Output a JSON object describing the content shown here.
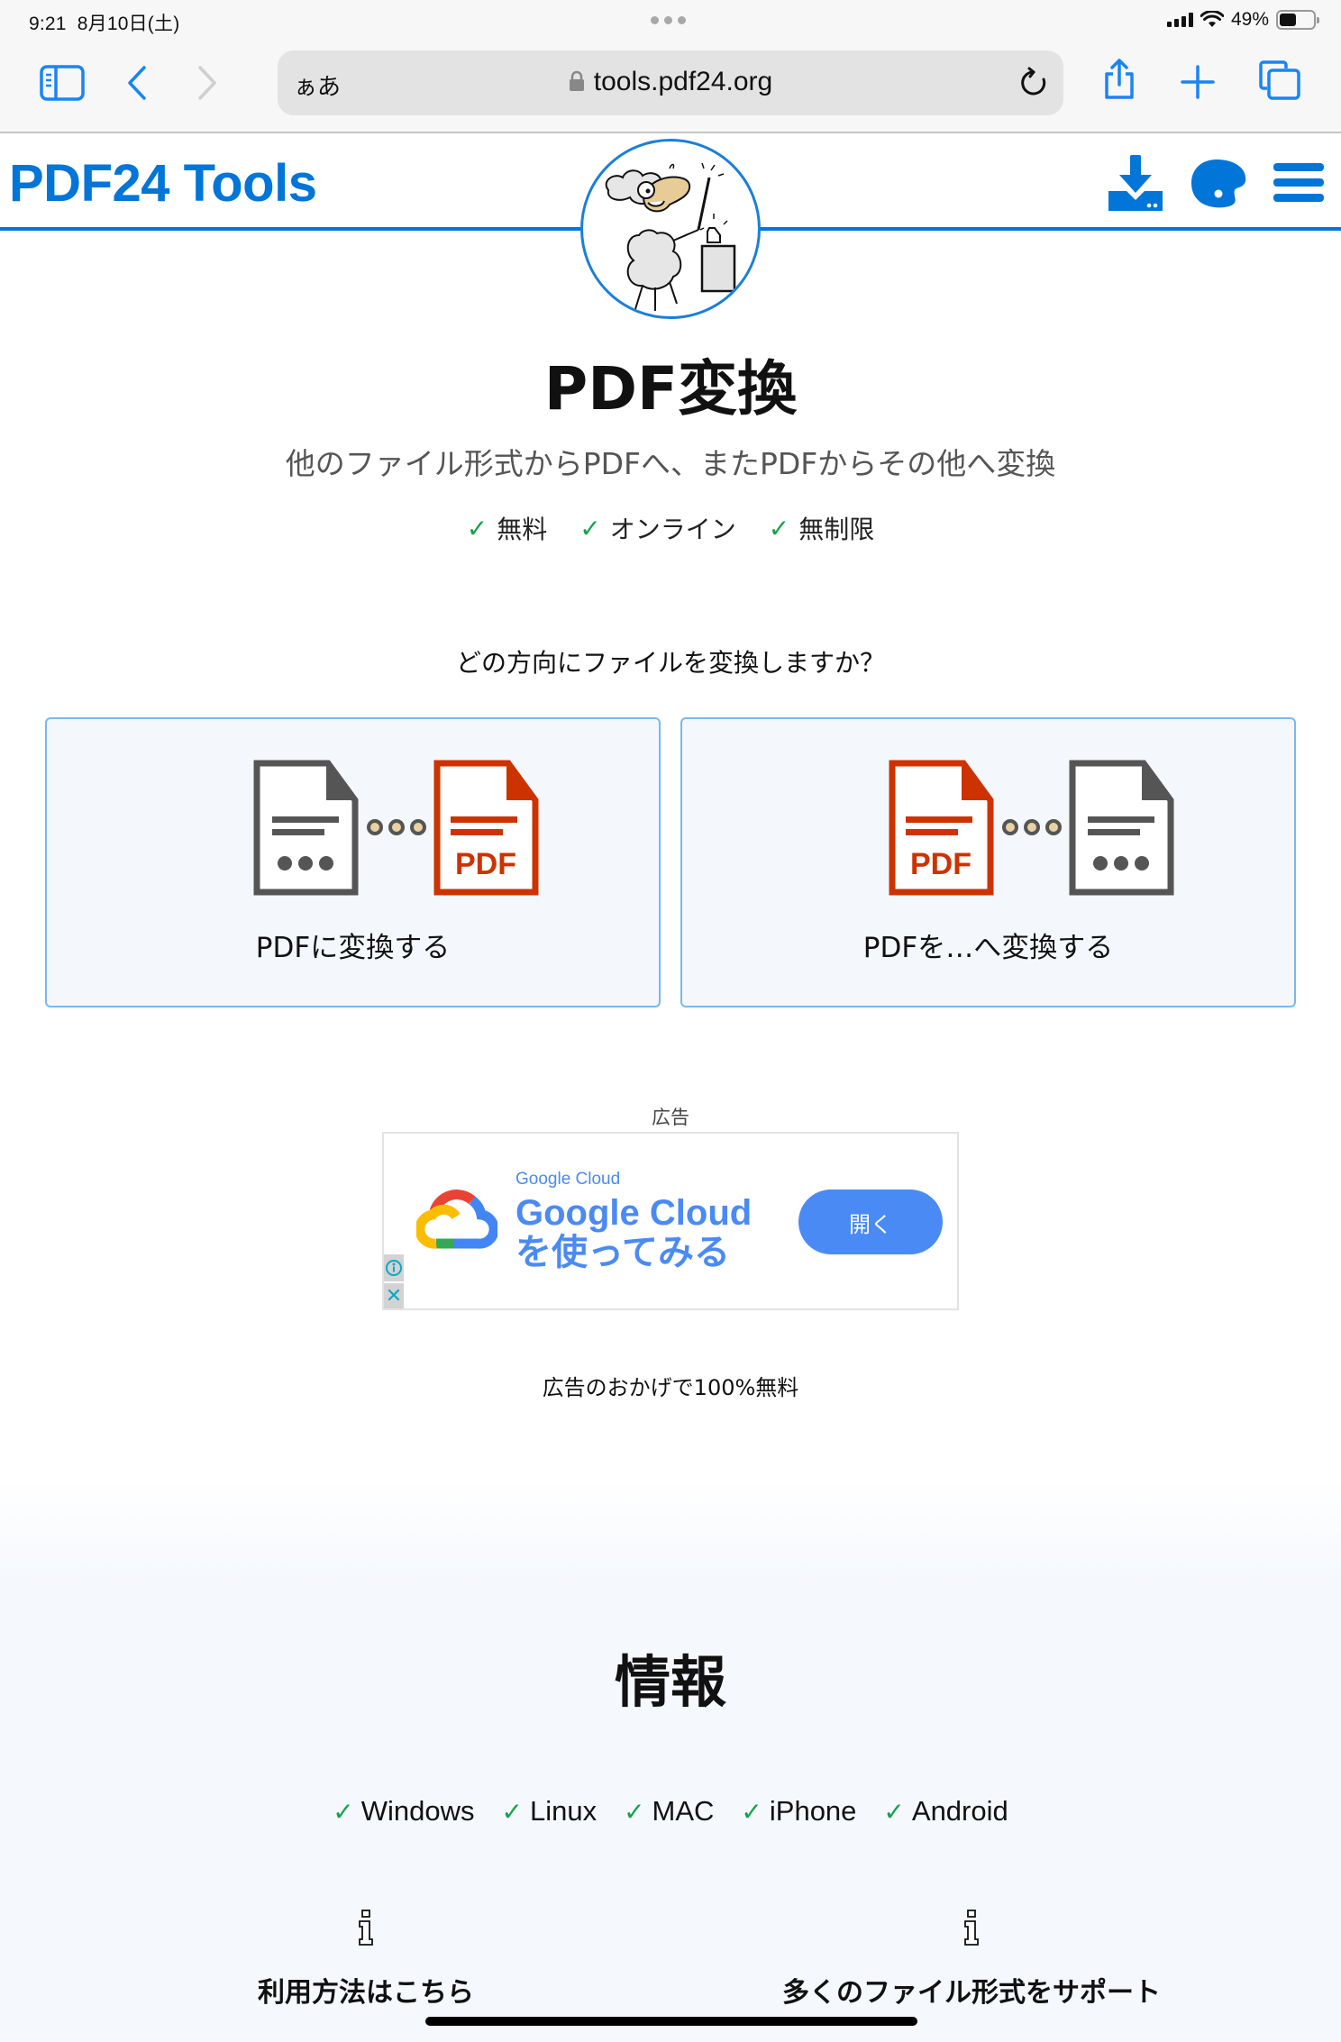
{
  "status_bar": {
    "time": "9:21",
    "date": "8月10日(土)",
    "battery_percent": "49%",
    "battery_level": 0.49
  },
  "browser": {
    "reader_label": "ぁあ",
    "url": "tools.pdf24.org",
    "icons": {
      "sidebar": "sidebar-icon",
      "back": "chevron-left-icon",
      "forward": "chevron-right-icon",
      "lock": "lock-icon",
      "reload": "reload-icon",
      "share": "share-icon",
      "new_tab": "plus-icon",
      "tabs": "tabs-icon"
    }
  },
  "header": {
    "brand": "PDF24 Tools",
    "icons": [
      "download-icon",
      "palette-icon",
      "hamburger-menu-icon"
    ],
    "brand_color": "#0275d8"
  },
  "hero": {
    "title": "PDF変換",
    "subtitle": "他のファイル形式からPDFへ、またPDFからその他へ変換",
    "features": [
      "無料",
      "オンライン",
      "無制限"
    ]
  },
  "question": "どの方向にファイルを変換しますか？",
  "cards": [
    {
      "label": "PDFに変換する",
      "from": "document",
      "to": "pdf"
    },
    {
      "label": "PDFを…へ変換する",
      "from": "pdf",
      "to": "document"
    }
  ],
  "pdf_icon_text": "PDF",
  "ad": {
    "label": "広告",
    "brand_small": "Google Cloud",
    "headline_line1": "Google Cloud",
    "headline_line2": "を使ってみる",
    "button": "開く",
    "info_icon": "ⓘ",
    "close_icon": "✕",
    "footer": "広告のおかげで100%無料"
  },
  "info": {
    "title": "情報",
    "platforms": [
      "Windows",
      "Linux",
      "MAC",
      "iPhone",
      "Android"
    ],
    "columns": [
      {
        "label": "利用方法はこちら"
      },
      {
        "label": "多くのファイル形式をサポート"
      }
    ]
  },
  "colors": {
    "accent": "#0275d8",
    "check_green": "#16a34a",
    "pdf_red": "#cc3300",
    "doc_gray": "#555555",
    "card_border": "#7ab8ee",
    "ad_blue": "#4a8af4"
  }
}
